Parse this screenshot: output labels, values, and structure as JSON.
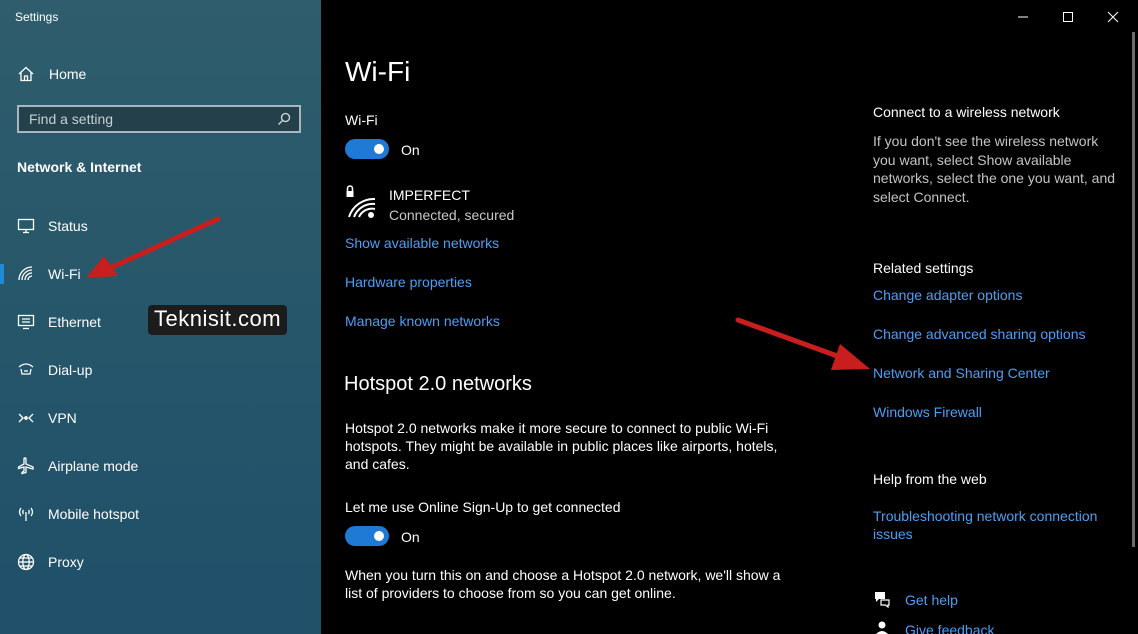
{
  "window": {
    "app_title": "Settings",
    "controls": {
      "minimize": "minimize-icon",
      "maximize": "maximize-icon",
      "close": "close-icon"
    }
  },
  "sidebar": {
    "home_label": "Home",
    "search_placeholder": "Find a setting",
    "section_title": "Network & Internet",
    "items": [
      {
        "label": "Status",
        "icon": "status-icon"
      },
      {
        "label": "Wi-Fi",
        "icon": "wifi-icon",
        "active": true
      },
      {
        "label": "Ethernet",
        "icon": "ethernet-icon"
      },
      {
        "label": "Dial-up",
        "icon": "dialup-icon"
      },
      {
        "label": "VPN",
        "icon": "vpn-icon"
      },
      {
        "label": "Airplane mode",
        "icon": "airplane-icon"
      },
      {
        "label": "Mobile hotspot",
        "icon": "hotspot-icon"
      },
      {
        "label": "Proxy",
        "icon": "proxy-icon"
      }
    ]
  },
  "watermark": "Teknisit.com",
  "main": {
    "title": "Wi-Fi",
    "wifi_label": "Wi-Fi",
    "wifi_toggle_state": "On",
    "network": {
      "name": "IMPERFECT",
      "status": "Connected, secured"
    },
    "links": [
      "Show available networks",
      "Hardware properties",
      "Manage known networks"
    ],
    "hotspot_title": "Hotspot 2.0 networks",
    "hotspot_description": "Hotspot 2.0 networks make it more secure to connect to public Wi-Fi hotspots. They might be available in public places like airports, hotels, and cafes.",
    "signup_label": "Let me use Online Sign-Up to get connected",
    "signup_toggle_state": "On",
    "signup_description": "When you turn this on and choose a Hotspot 2.0 network, we'll show a list of providers to choose from so you can get online."
  },
  "right_panel": {
    "connect_title": "Connect to a wireless network",
    "connect_text": "If you don't see the wireless network you want, select Show available networks, select the one you want, and select Connect.",
    "related_title": "Related settings",
    "related_links": [
      "Change adapter options",
      "Change advanced sharing options",
      "Network and Sharing Center",
      "Windows Firewall"
    ],
    "help_title": "Help from the web",
    "help_link": "Troubleshooting network connection issues",
    "get_help": "Get help",
    "give_feedback": "Give feedback"
  },
  "colors": {
    "accent": "#1f7ad6",
    "link": "#4d9ff5",
    "sidebar": "#27576a",
    "annotation_arrow": "#c81e1e"
  }
}
